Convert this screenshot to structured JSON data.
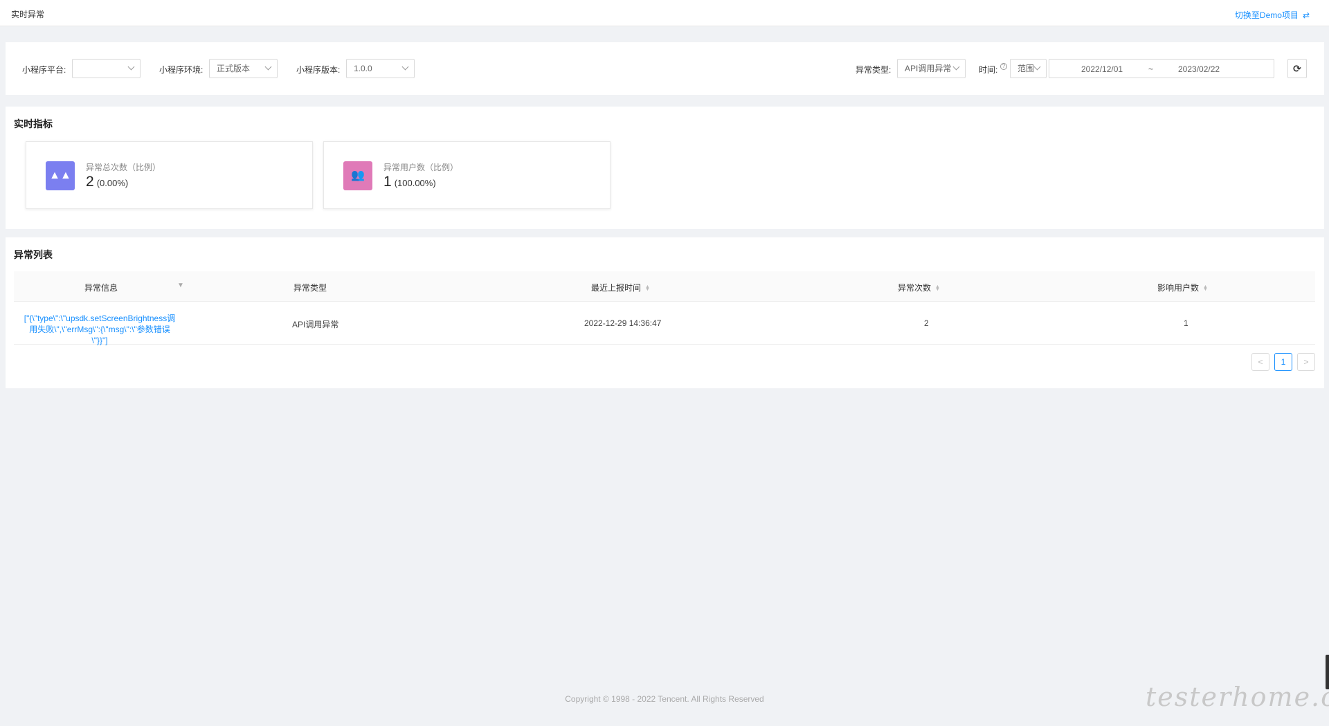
{
  "header": {
    "title": "实时异常",
    "switch_label": "切换至Demo项目"
  },
  "filters": {
    "platform_label": "小程序平台:",
    "platform_value": "",
    "env_label": "小程序环境:",
    "env_value": "正式版本",
    "version_label": "小程序版本:",
    "version_value": "1.0.0",
    "type_label": "异常类型:",
    "type_value": "API调用异常",
    "time_label": "时间:",
    "range_value": "范围",
    "date_start": "2022/12/01",
    "date_sep": "~",
    "date_end": "2023/02/22"
  },
  "metrics": {
    "title": "实时指标",
    "cards": [
      {
        "label": "异常总次数（比例）",
        "value": "2",
        "pct": "(0.00%)",
        "color": "#7b7ff0"
      },
      {
        "label": "异常用户数（比例）",
        "value": "1",
        "pct": "(100.00%)",
        "color": "#e07ab8"
      }
    ]
  },
  "list": {
    "title": "异常列表",
    "columns": [
      "异常信息",
      "异常类型",
      "最近上报时间",
      "异常次数",
      "影响用户数"
    ],
    "rows": [
      {
        "msg": "[\"{\\\"type\\\":\\\"upsdk.setScreenBrightness调用失败\\\",\\\"errMsg\\\":{\\\"msg\\\":\\\"参数错误\\\"}}\"]",
        "type": "API调用异常",
        "time": "2022-12-29 14:36:47",
        "count": "2",
        "users": "1"
      }
    ],
    "pagination": {
      "prev": "<",
      "current": "1",
      "next": ">"
    }
  },
  "footer": {
    "copyright": "Copyright © 1998 - 2022 Tencent. All Rights Reserved"
  },
  "watermark": "testerhome.com",
  "colors": {
    "accent": "#1890ff",
    "background": "#f0f2f5"
  }
}
